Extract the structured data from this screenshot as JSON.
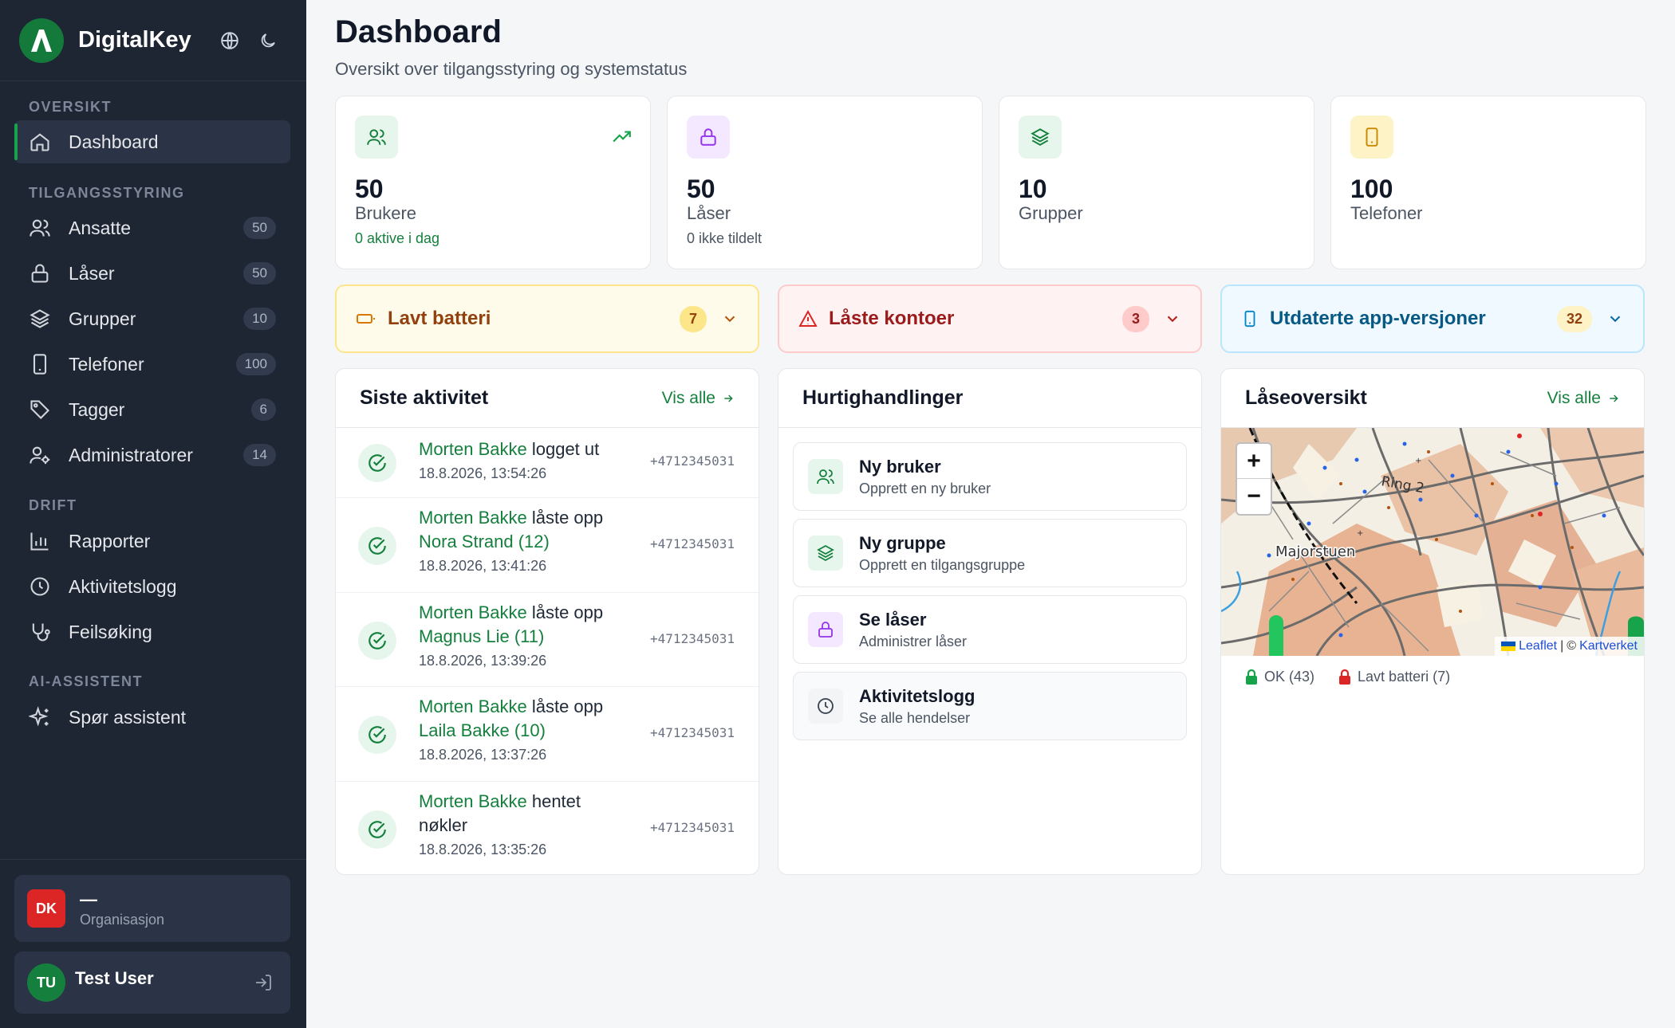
{
  "app": {
    "name": "DigitalKey"
  },
  "sidebar": {
    "sections": [
      {
        "title": "OVERSIKT"
      },
      {
        "title": "TILGANGSSTYRING"
      },
      {
        "title": "DRIFT"
      },
      {
        "title": "AI-ASSISTENT"
      }
    ],
    "items": [
      {
        "label": "Dashboard",
        "icon": "home-icon"
      },
      {
        "label": "Ansatte",
        "count": "50",
        "icon": "users-icon"
      },
      {
        "label": "Låser",
        "count": "50",
        "icon": "lock-icon"
      },
      {
        "label": "Grupper",
        "count": "10",
        "icon": "layers-icon"
      },
      {
        "label": "Telefoner",
        "count": "100",
        "icon": "phone-icon"
      },
      {
        "label": "Tagger",
        "count": "6",
        "icon": "tag-icon"
      },
      {
        "label": "Administratorer",
        "count": "14",
        "icon": "user-cog-icon"
      },
      {
        "label": "Rapporter",
        "icon": "bar-chart-icon"
      },
      {
        "label": "Aktivitetslogg",
        "icon": "clock-icon"
      },
      {
        "label": "Feilsøking",
        "icon": "stethoscope-icon"
      },
      {
        "label": "Spør assistent",
        "icon": "sparkles-icon"
      }
    ],
    "org": {
      "initials": "DK",
      "name": "—",
      "type": "Organisasjon"
    },
    "user": {
      "initials": "TU",
      "name": "Test User"
    }
  },
  "header": {
    "title": "Dashboard",
    "subtitle": "Oversikt over tilgangsstyring og systemstatus"
  },
  "stats": [
    {
      "value": "50",
      "label": "Brukere",
      "sub": "0 aktive i dag"
    },
    {
      "value": "50",
      "label": "Låser",
      "sub": "0 ikke tildelt"
    },
    {
      "value": "10",
      "label": "Grupper"
    },
    {
      "value": "100",
      "label": "Telefoner"
    }
  ],
  "alerts": [
    {
      "title": "Lavt batteri",
      "count": "7"
    },
    {
      "title": "Låste kontoer",
      "count": "3"
    },
    {
      "title": "Utdaterte app-versjoner",
      "count": "32"
    }
  ],
  "activity": {
    "title": "Siste aktivitet",
    "link": "Vis alle",
    "rows": [
      {
        "user": "Morten Bakke",
        "action": " logget ut",
        "target": "",
        "time": "18.8.2026, 13:54:26",
        "phone": "+4712345031"
      },
      {
        "user": "Morten Bakke",
        "action": " låste opp",
        "target": "Nora Strand (12)",
        "time": "18.8.2026, 13:41:26",
        "phone": "+4712345031"
      },
      {
        "user": "Morten Bakke",
        "action": " låste opp",
        "target": "Magnus Lie (11)",
        "time": "18.8.2026, 13:39:26",
        "phone": "+4712345031"
      },
      {
        "user": "Morten Bakke",
        "action": " låste opp",
        "target": "Laila Bakke (10)",
        "time": "18.8.2026, 13:37:26",
        "phone": "+4712345031"
      },
      {
        "user": "Morten Bakke",
        "action": " hentet nøkler",
        "target": "",
        "time": "18.8.2026, 13:35:26",
        "phone": "+4712345031"
      }
    ]
  },
  "quick": {
    "title": "Hurtighandlinger",
    "items": [
      {
        "title": "Ny bruker",
        "sub": "Opprett en ny bruker"
      },
      {
        "title": "Ny gruppe",
        "sub": "Opprett en tilgangsgruppe"
      },
      {
        "title": "Se låser",
        "sub": "Administrer låser"
      },
      {
        "title": "Aktivitetslogg",
        "sub": "Se alle hendelser"
      }
    ]
  },
  "locks": {
    "title": "Låseoversikt",
    "link": "Vis alle",
    "map": {
      "place": "Majorstuen",
      "road": "Ring 2",
      "zoom_in": "+",
      "zoom_out": "−",
      "attr_leaflet": "Leaflet",
      "attr_sep": "|",
      "attr_copy": "©",
      "attr_source": "Kartverket"
    },
    "legend": [
      {
        "label": "OK (43)",
        "color": "#16a34a"
      },
      {
        "label": "Lavt batteri (7)",
        "color": "#dc2626"
      }
    ]
  }
}
